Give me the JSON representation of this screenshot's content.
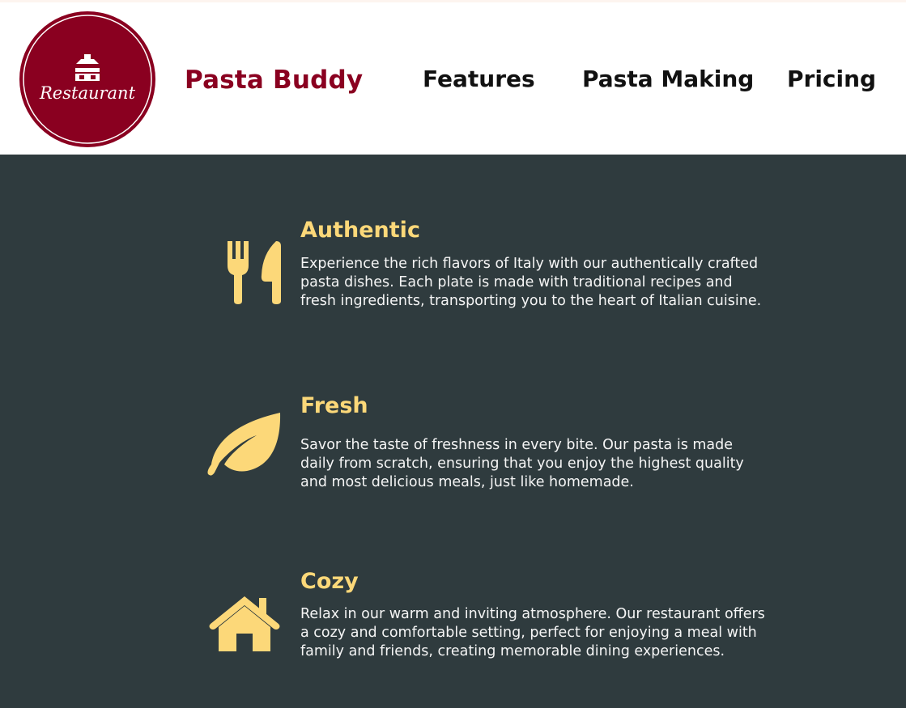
{
  "logo": {
    "text": "Restaurant"
  },
  "brand": "Pasta Buddy",
  "nav": [
    "Features",
    "Pasta Making",
    "Pricing"
  ],
  "features": [
    {
      "title": "Authentic",
      "text": "Experience the rich flavors of Italy with our authentically crafted pasta dishes. Each plate is made with traditional recipes and fresh ingredients, transporting you to the heart of Italian cuisine.",
      "icon": "utensils-icon"
    },
    {
      "title": "Fresh",
      "text": "Savor the taste of freshness in every bite. Our pasta is made daily from scratch, ensuring that you enjoy the highest quality and most delicious meals, just like homemade.",
      "icon": "leaf-icon"
    },
    {
      "title": "Cozy",
      "text": "Relax in our warm and inviting atmosphere. Our restaurant offers a cozy and comfortable setting, perfect for enjoying a meal with family and friends, creating memorable dining experiences.",
      "icon": "house-icon"
    }
  ],
  "colors": {
    "brand": "#8a0020",
    "accent": "#fcd879",
    "section_bg": "#2f3b3e"
  }
}
